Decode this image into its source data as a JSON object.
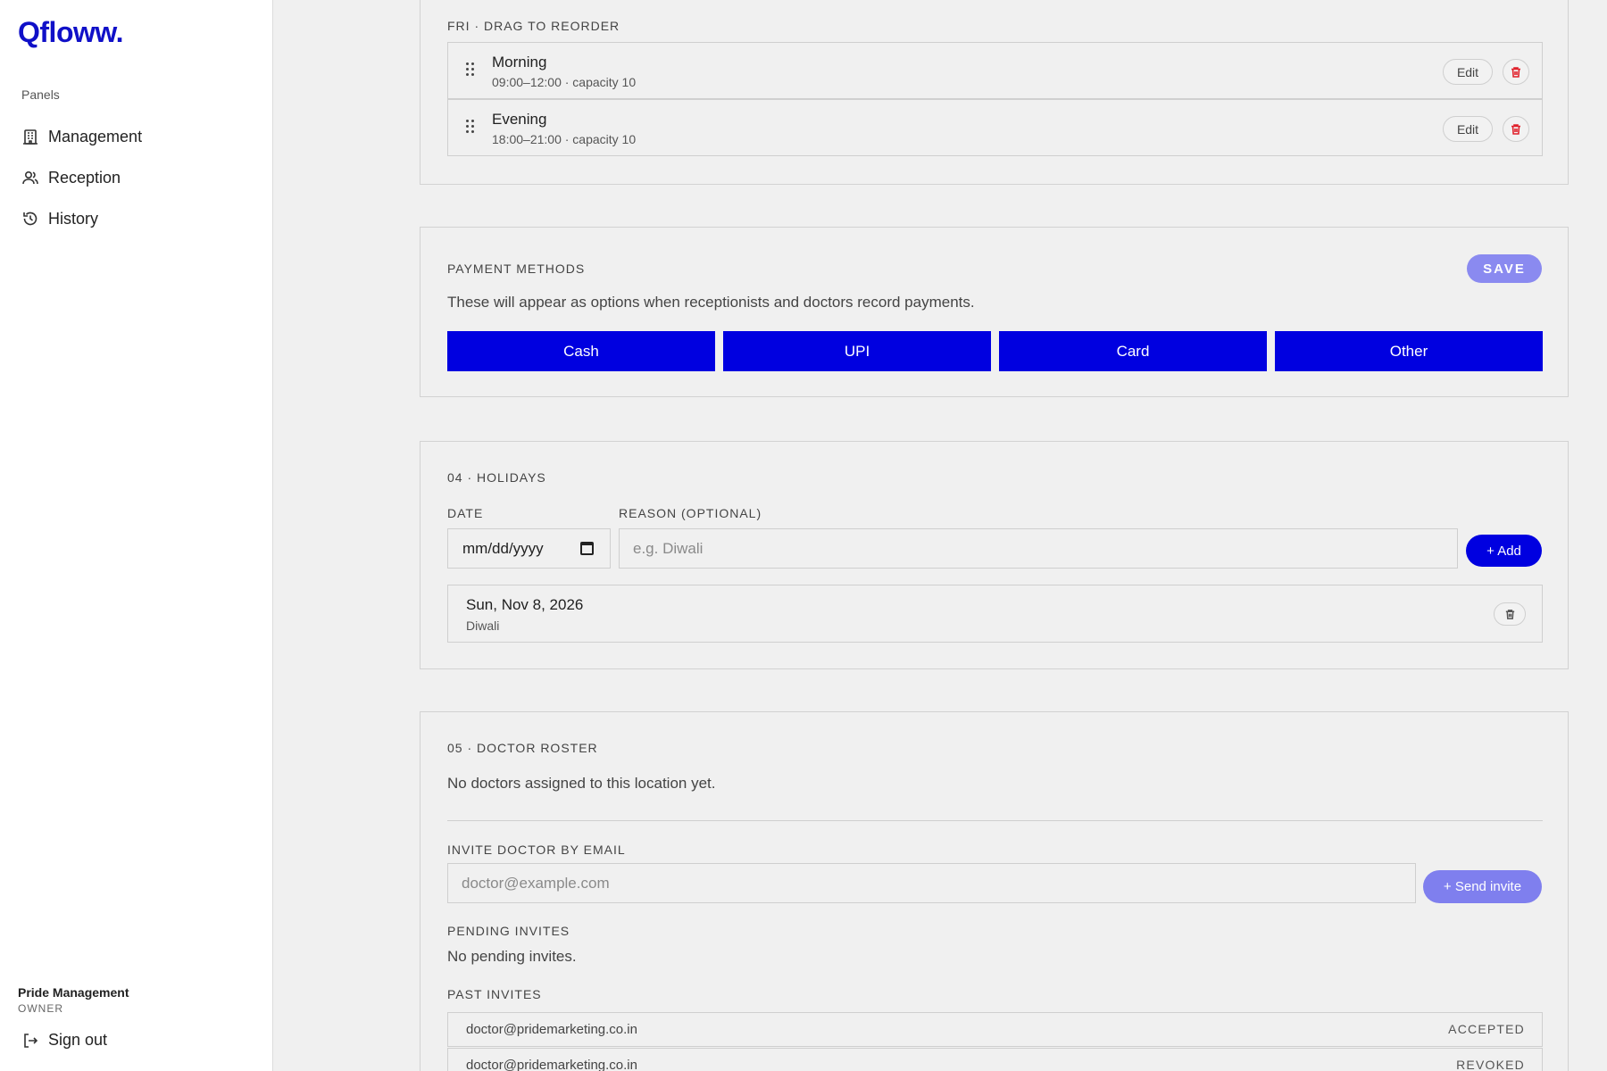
{
  "app": {
    "logo": "Qfloww."
  },
  "sidebar": {
    "panels_label": "Panels",
    "items": [
      {
        "label": "Management",
        "icon": "building-icon"
      },
      {
        "label": "Reception",
        "icon": "users-icon"
      },
      {
        "label": "History",
        "icon": "history-icon"
      }
    ],
    "user": {
      "name": "Pride Management",
      "role": "OWNER"
    },
    "signout_label": "Sign out"
  },
  "schedule": {
    "title": "FRI · DRAG TO REORDER",
    "slots": [
      {
        "name": "Morning",
        "meta": "09:00–12:00 · capacity 10"
      },
      {
        "name": "Evening",
        "meta": "18:00–21:00 · capacity 10"
      }
    ],
    "edit_label": "Edit"
  },
  "payment": {
    "title": "PAYMENT METHODS",
    "save_label": "SAVE",
    "description": "These will appear as options when receptionists and doctors record payments.",
    "methods": [
      "Cash",
      "UPI",
      "Card",
      "Other"
    ]
  },
  "holidays": {
    "title": "04 · HOLIDAYS",
    "date_label": "DATE",
    "reason_label": "REASON (OPTIONAL)",
    "date_value": "mm/dd/yyyy",
    "reason_placeholder": "e.g. Diwali",
    "add_label": "+ Add",
    "items": [
      {
        "date": "Sun, Nov 8, 2026",
        "reason": "Diwali"
      }
    ]
  },
  "roster": {
    "title": "05 · DOCTOR ROSTER",
    "empty_text": "No doctors assigned to this location yet.",
    "invite_label": "INVITE DOCTOR BY EMAIL",
    "invite_placeholder": "doctor@example.com",
    "send_label": "+ Send invite",
    "pending_label": "PENDING INVITES",
    "pending_empty": "No pending invites.",
    "past_label": "PAST INVITES",
    "past_invites": [
      {
        "email": "doctor@pridemarketing.co.in",
        "status": "ACCEPTED"
      },
      {
        "email": "doctor@pridemarketing.co.in",
        "status": "REVOKED"
      }
    ]
  },
  "colors": {
    "brand": "#1010c8",
    "primary": "#0000e0",
    "muted_primary": "#8a8af0",
    "danger": "#e0202a"
  }
}
